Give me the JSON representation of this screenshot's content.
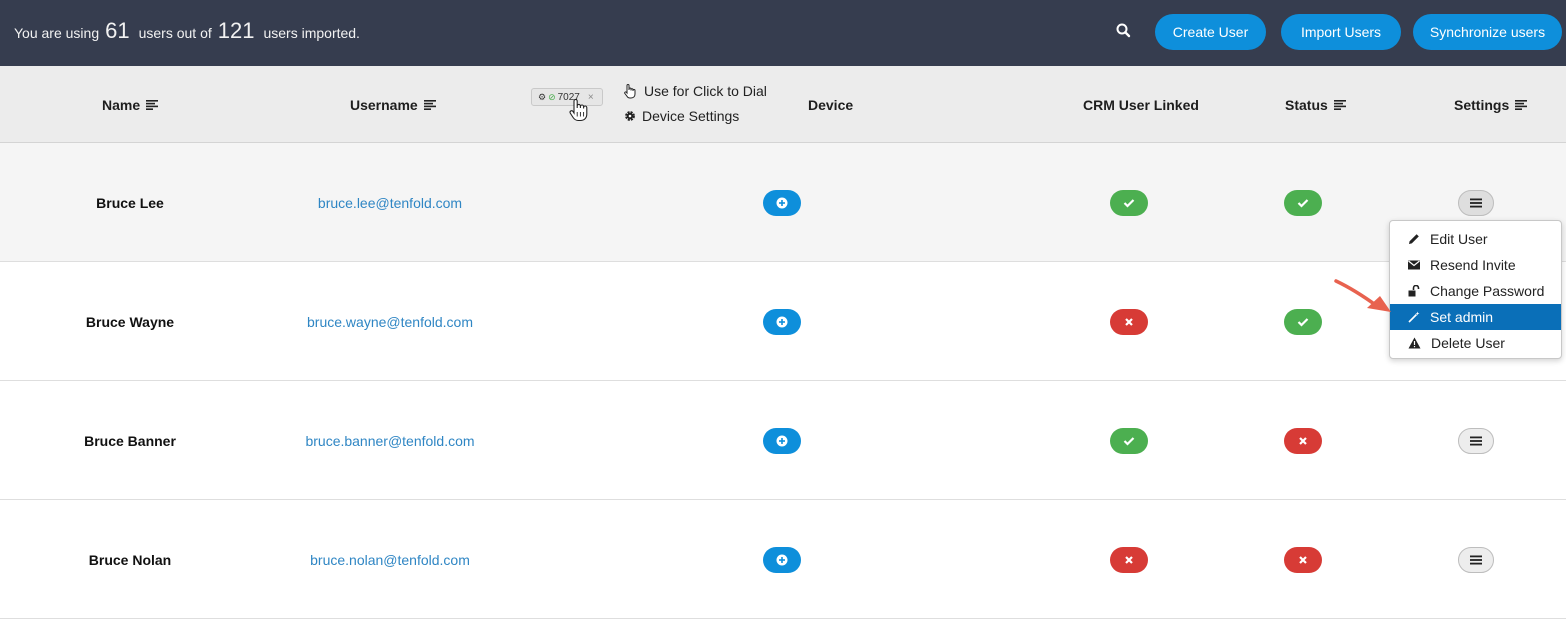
{
  "topbar": {
    "usage_prefix": "You are using",
    "used_count": "61",
    "usage_middle": "users out of",
    "total_count": "121",
    "usage_suffix": "users imported.",
    "search_icon": "search-icon",
    "buttons": {
      "create": "Create User",
      "import": "Import Users",
      "sync": "Synchronize users"
    },
    "button_color": "#0e8fdb",
    "background": "#363d4f"
  },
  "columns": {
    "name": "Name",
    "username": "Username",
    "device": "Device",
    "crm": "CRM User Linked",
    "status": "Status",
    "settings": "Settings"
  },
  "device_tag": {
    "label": "7027",
    "close": "×"
  },
  "device_options": {
    "click_to_dial": "Use for Click to Dial",
    "device_settings": "Device Settings"
  },
  "rows": [
    {
      "name": "Bruce Lee",
      "username": "bruce.lee@tenfold.com",
      "crm_linked": true,
      "status_active": true
    },
    {
      "name": "Bruce Wayne",
      "username": "bruce.wayne@tenfold.com",
      "crm_linked": false,
      "status_active": true
    },
    {
      "name": "Bruce Banner",
      "username": "bruce.banner@tenfold.com",
      "crm_linked": true,
      "status_active": false
    },
    {
      "name": "Bruce Nolan",
      "username": "bruce.nolan@tenfold.com",
      "crm_linked": false,
      "status_active": false
    }
  ],
  "settings_menu": {
    "items": [
      {
        "label": "Edit User",
        "icon": "pencil-icon"
      },
      {
        "label": "Resend Invite",
        "icon": "envelope-icon"
      },
      {
        "label": "Change Password",
        "icon": "unlock-icon"
      },
      {
        "label": "Set admin",
        "icon": "magic-wand-icon",
        "selected": true
      },
      {
        "label": "Delete User",
        "icon": "warning-icon"
      }
    ]
  },
  "colors": {
    "success": "#4caf50",
    "danger": "#d73b36",
    "link": "#2f86c4",
    "menu_selected": "#0a6fb8",
    "annotation_arrow": "#e8624f"
  }
}
